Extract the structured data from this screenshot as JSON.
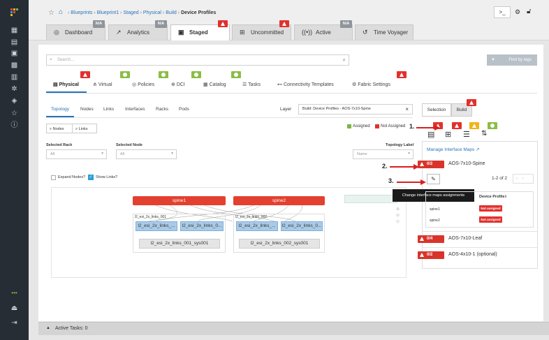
{
  "breadcrumb": [
    "Blueprints",
    "Blueprint1",
    "Staged",
    "Physical",
    "Build"
  ],
  "breadcrumb_current": "Device Profiles",
  "main_tabs": [
    {
      "label": "Dashboard",
      "badge": "N/A"
    },
    {
      "label": "Analytics",
      "badge": "N/A"
    },
    {
      "label": "Staged"
    },
    {
      "label": "Uncommitted"
    },
    {
      "label": "Active",
      "badge": "N/A"
    },
    {
      "label": "Time Voyager"
    }
  ],
  "search": {
    "placeholder": "Search..."
  },
  "find_by_tags": "Find by tags",
  "sub_tabs": [
    "Physical",
    "Virtual",
    "Policies",
    "DCI",
    "Catalog",
    "Tasks",
    "Connectivity Templates",
    "Fabric Settings"
  ],
  "layer_tabs": [
    "Topology",
    "Nodes",
    "Links",
    "Interfaces",
    "Racks",
    "Pods"
  ],
  "layer": {
    "label": "Layer",
    "value": "Build: Device Profiles - AOS-7x10-Spine",
    "clear": "×"
  },
  "search_buttons": {
    "nodes": "Nodes",
    "links": "Links"
  },
  "legend": {
    "assigned": "Assigned",
    "not_assigned": "Not Assigned",
    "assigned_color": "#7ab648",
    "not_assigned_color": "#d9342b"
  },
  "filters": {
    "selected_rack": {
      "label": "Selected Rack",
      "value": "All"
    },
    "selected_node": {
      "label": "Selected Node",
      "value": "All"
    },
    "topology_label": {
      "label": "Topology Label",
      "value": "Name"
    }
  },
  "checkboxes": {
    "expand_nodes": "Expand Nodes?",
    "show_links": "Show Links?"
  },
  "topology": {
    "spines": [
      "spine1",
      "spine2"
    ],
    "racks": [
      {
        "name": "l2_esi_2x_links_001",
        "leaves": [
          "l2_esi_2x_links_...",
          "l2_esi_2x_links_0..."
        ],
        "system": "l2_esi_2x_links_001_sys001"
      },
      {
        "name": "l2_esi_2x_links_002",
        "leaves": [
          "l2_esi_2x_links_...",
          "l2_esi_2x_links_0..."
        ],
        "system": "l2_esi_2x_links_002_sys001"
      }
    ]
  },
  "right_panel": {
    "tabs": [
      "Selection",
      "Build"
    ],
    "manage_link": "Manage Interface Maps",
    "profiles": [
      {
        "badge": "0/2",
        "name": "AOS-7x10-Spine"
      },
      {
        "badge": "0/4",
        "name": "AOS-7x10-Leaf"
      },
      {
        "badge": "0/2",
        "name": "AOS-4x10-1 (optional)"
      }
    ],
    "pagination": "1-2 of 2",
    "tooltip": "Change interface maps assignments",
    "table_header": "Device Profile",
    "table_rows": [
      {
        "name": "spine1",
        "status": "Not assigned"
      },
      {
        "name": "spine2",
        "status": "Not assigned"
      }
    ]
  },
  "annotations": [
    "1.",
    "2.",
    "3."
  ],
  "footer": {
    "active_tasks": "Active Tasks: 0"
  }
}
